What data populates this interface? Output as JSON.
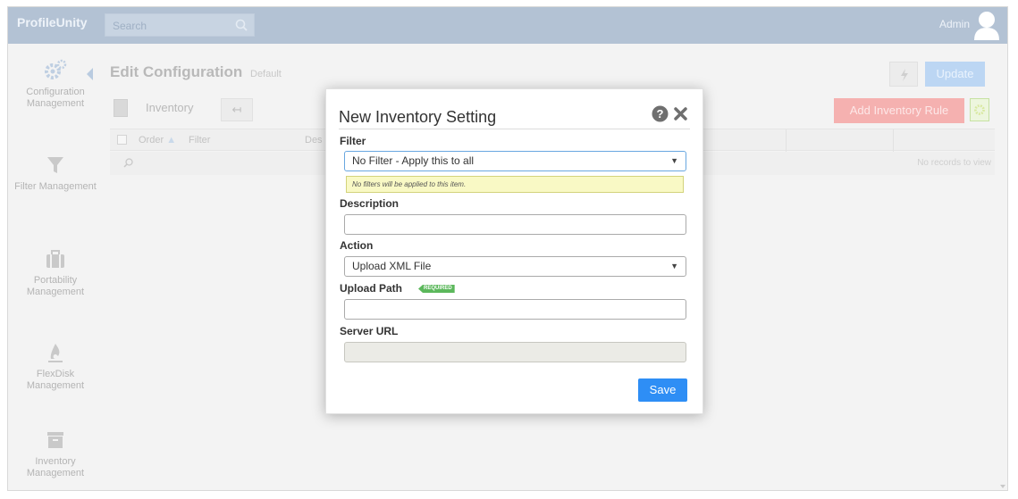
{
  "topbar": {
    "brand": "ProfileUnity",
    "search_placeholder": "Search",
    "user": "Admin"
  },
  "sidebar": {
    "items": [
      {
        "label": "Configuration Management",
        "icon": "gears-icon"
      },
      {
        "label": "Filter Management",
        "icon": "filter-icon"
      },
      {
        "label": "Portability Management",
        "icon": "briefcase-icon"
      },
      {
        "label": "FlexDisk Management",
        "icon": "flame-icon"
      },
      {
        "label": "Inventory Management",
        "icon": "archive-icon"
      }
    ]
  },
  "main": {
    "title": "Edit Configuration",
    "subtitle": "Default",
    "update_label": "Update",
    "section_label": "Inventory",
    "add_rule_label": "Add Inventory Rule",
    "grid": {
      "columns": [
        "Order",
        "Filter",
        "Des"
      ],
      "empty_text": "No records to view"
    }
  },
  "modal": {
    "title": "New Inventory Setting",
    "filter_label": "Filter",
    "filter_value": "No Filter - Apply this to all",
    "filter_hint": "No filters will be applied to this item.",
    "description_label": "Description",
    "description_value": "",
    "action_label": "Action",
    "action_value": "Upload XML File",
    "upload_path_label": "Upload Path",
    "required_badge": "REQUIRED",
    "upload_path_value": "",
    "server_url_label": "Server URL",
    "server_url_value": "",
    "save_label": "Save"
  },
  "colors": {
    "topbar": "#b3c2d4",
    "primary_button": "#2e8ef5",
    "required_badge": "#5cb85c",
    "hint_background": "#f9f9c5"
  }
}
